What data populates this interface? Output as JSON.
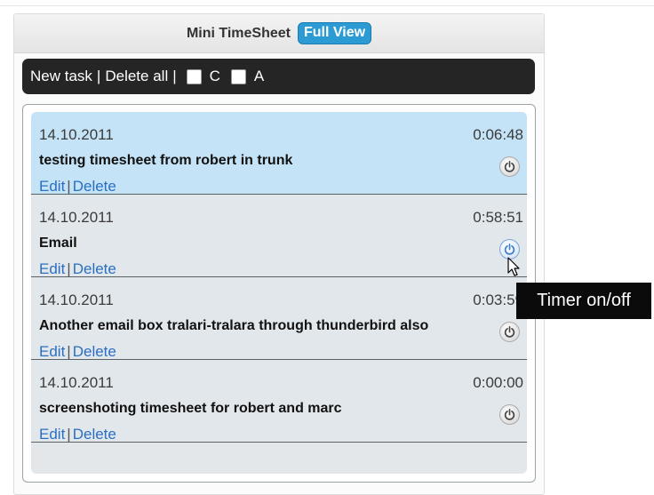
{
  "header": {
    "title": "Mini TimeSheet",
    "full_view_label": "Full View"
  },
  "toolbar": {
    "new_task_label": "New task",
    "separator": "|",
    "delete_all_label": "Delete all",
    "checkbox_c_label": "C",
    "checkbox_a_label": "A"
  },
  "entries": [
    {
      "date": "14.10.2011",
      "duration": "0:06:48",
      "description": "testing timesheet from robert in trunk",
      "edit_label": "Edit",
      "delete_label": "Delete"
    },
    {
      "date": "14.10.2011",
      "duration": "0:58:51",
      "description": "Email",
      "edit_label": "Edit",
      "delete_label": "Delete"
    },
    {
      "date": "14.10.2011",
      "duration": "0:03:59",
      "description": "Another email box tralari-tralara through thunderbird also",
      "edit_label": "Edit",
      "delete_label": "Delete"
    },
    {
      "date": "14.10.2011",
      "duration": "0:00:00",
      "description": "screenshoting timesheet for robert and marc",
      "edit_label": "Edit",
      "delete_label": "Delete"
    }
  ],
  "tooltip": {
    "text": "Timer on/off"
  },
  "icons": {
    "timer_toggle": "power-icon",
    "cursor": "mouse-pointer-icon"
  },
  "colors": {
    "accent": "#2d9bd3",
    "toolbar_bg": "#252525",
    "link": "#2a6fc1",
    "selected_row": "#c5e3f6"
  }
}
